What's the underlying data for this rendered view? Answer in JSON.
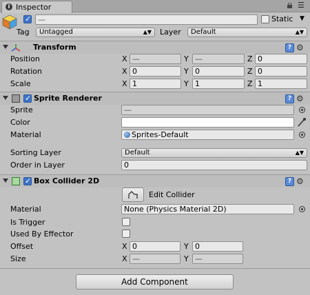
{
  "tab": {
    "title": "Inspector"
  },
  "header": {
    "name_value": "—",
    "static_label": "Static",
    "tag_label": "Tag",
    "tag_value": "Untagged",
    "layer_label": "Layer",
    "layer_value": "Default"
  },
  "transform": {
    "title": "Transform",
    "position_label": "Position",
    "rotation_label": "Rotation",
    "scale_label": "Scale",
    "position": {
      "x": "—",
      "y": "—",
      "z": "0"
    },
    "rotation": {
      "x": "0",
      "y": "0",
      "z": "0"
    },
    "scale": {
      "x": "1",
      "y": "1",
      "z": "1"
    }
  },
  "axes": {
    "x": "X",
    "y": "Y",
    "z": "Z"
  },
  "sprite_renderer": {
    "title": "Sprite Renderer",
    "sprite_label": "Sprite",
    "sprite_value": "—",
    "color_label": "Color",
    "material_label": "Material",
    "material_value": "Sprites-Default",
    "sorting_layer_label": "Sorting Layer",
    "sorting_layer_value": "Default",
    "order_label": "Order in Layer",
    "order_value": "0"
  },
  "box_collider": {
    "title": "Box Collider 2D",
    "edit_collider_label": "Edit Collider",
    "material_label": "Material",
    "material_value": "None (Physics Material 2D)",
    "is_trigger_label": "Is Trigger",
    "used_by_effector_label": "Used By Effector",
    "offset_label": "Offset",
    "offset": {
      "x": "0",
      "y": "0"
    },
    "size_label": "Size",
    "size": {
      "x": "—",
      "y": "—"
    }
  },
  "add_component_label": "Add Component",
  "colors": {
    "accent": "#3b73c6",
    "panel": "#c2c2c2",
    "field": "#e8e8e8"
  }
}
